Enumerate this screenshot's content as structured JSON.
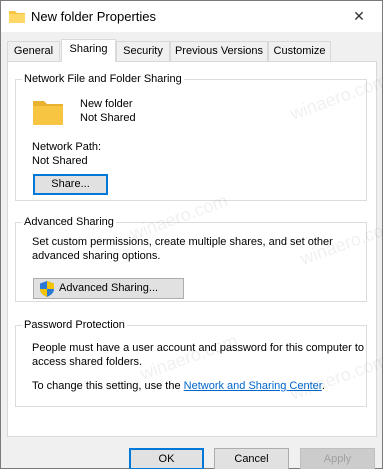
{
  "window": {
    "title": "New folder Properties",
    "close_glyph": "✕"
  },
  "tabs": [
    {
      "label": "General"
    },
    {
      "label": "Sharing",
      "active": true
    },
    {
      "label": "Security"
    },
    {
      "label": "Previous Versions"
    },
    {
      "label": "Customize"
    }
  ],
  "network_sharing": {
    "title": "Network File and Folder Sharing",
    "folder_name": "New folder",
    "folder_status": "Not Shared",
    "network_path_label": "Network Path:",
    "network_path_value": "Not Shared",
    "share_button": "Share..."
  },
  "advanced_sharing": {
    "title": "Advanced Sharing",
    "description_line1": "Set custom permissions, create multiple shares, and set other",
    "description_line2": "advanced sharing options.",
    "button": "Advanced Sharing..."
  },
  "password_protection": {
    "title": "Password Protection",
    "line1": "People must have a user account and password for this computer to",
    "line2": "access shared folders.",
    "change_prefix": "To change this setting, use the ",
    "link": "Network and Sharing Center",
    "change_suffix": "."
  },
  "footer": {
    "ok": "OK",
    "cancel": "Cancel",
    "apply": "Apply"
  },
  "watermark": "winaero.com",
  "colors": {
    "folder": "#f8c543",
    "link": "#0066cc",
    "focus": "#0078d7",
    "shield_blue": "#2b79d3",
    "shield_yellow": "#f5c400"
  }
}
